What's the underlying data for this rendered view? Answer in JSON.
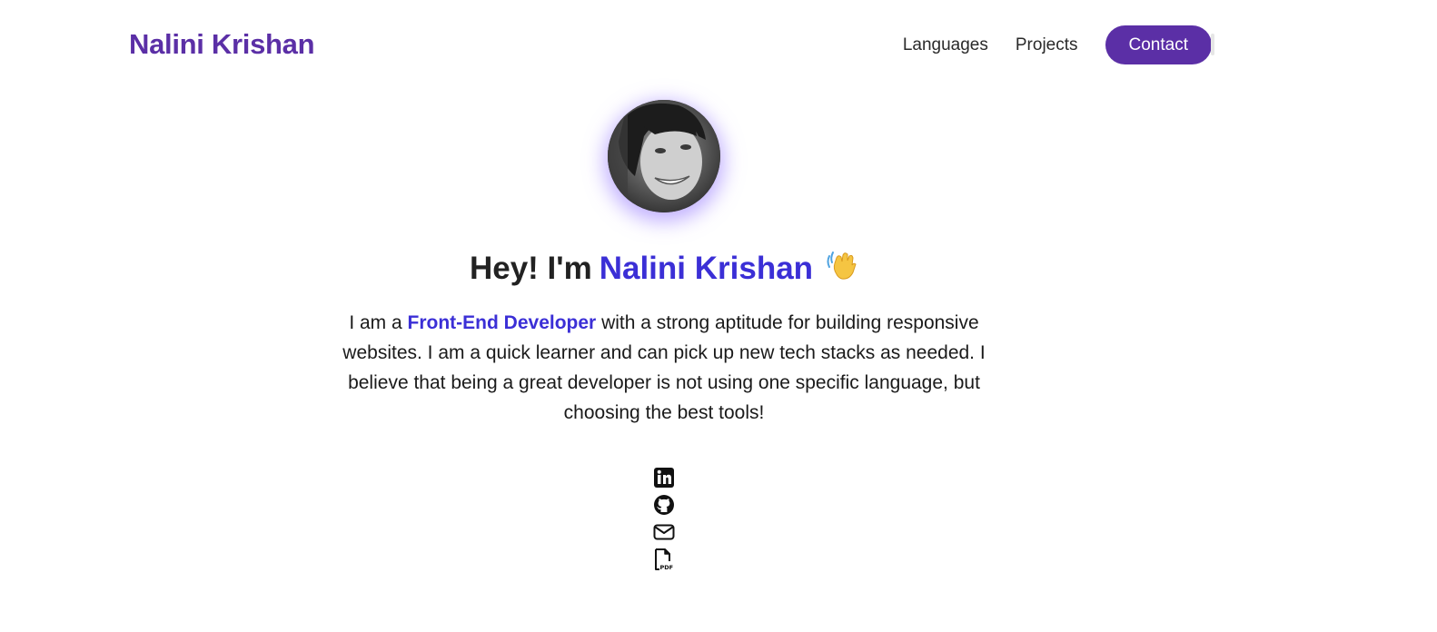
{
  "header": {
    "brand": "Nalini Krishan",
    "nav": [
      {
        "label": "Languages"
      },
      {
        "label": "Projects"
      }
    ],
    "contact_label": "Contact"
  },
  "hero": {
    "greeting_prefix": "Hey! I'm",
    "greeting_name": "Nalini Krishan",
    "wave_icon": "waving-hand-icon",
    "bio_before": "I am a",
    "bio_role": "Front-End Developer",
    "bio_after": "with a strong aptitude for building responsive websites. I am a quick learner and can pick up new tech stacks as needed. I believe that being a great developer is not using one specific language, but choosing the best tools!"
  },
  "socials": [
    {
      "icon": "linkedin-icon"
    },
    {
      "icon": "github-icon"
    },
    {
      "icon": "mail-icon"
    },
    {
      "icon": "pdf-file-icon"
    }
  ],
  "colors": {
    "brand": "#5b2fa6",
    "accent": "#3b2fd6",
    "avatar_glow": "#8c6eff"
  }
}
